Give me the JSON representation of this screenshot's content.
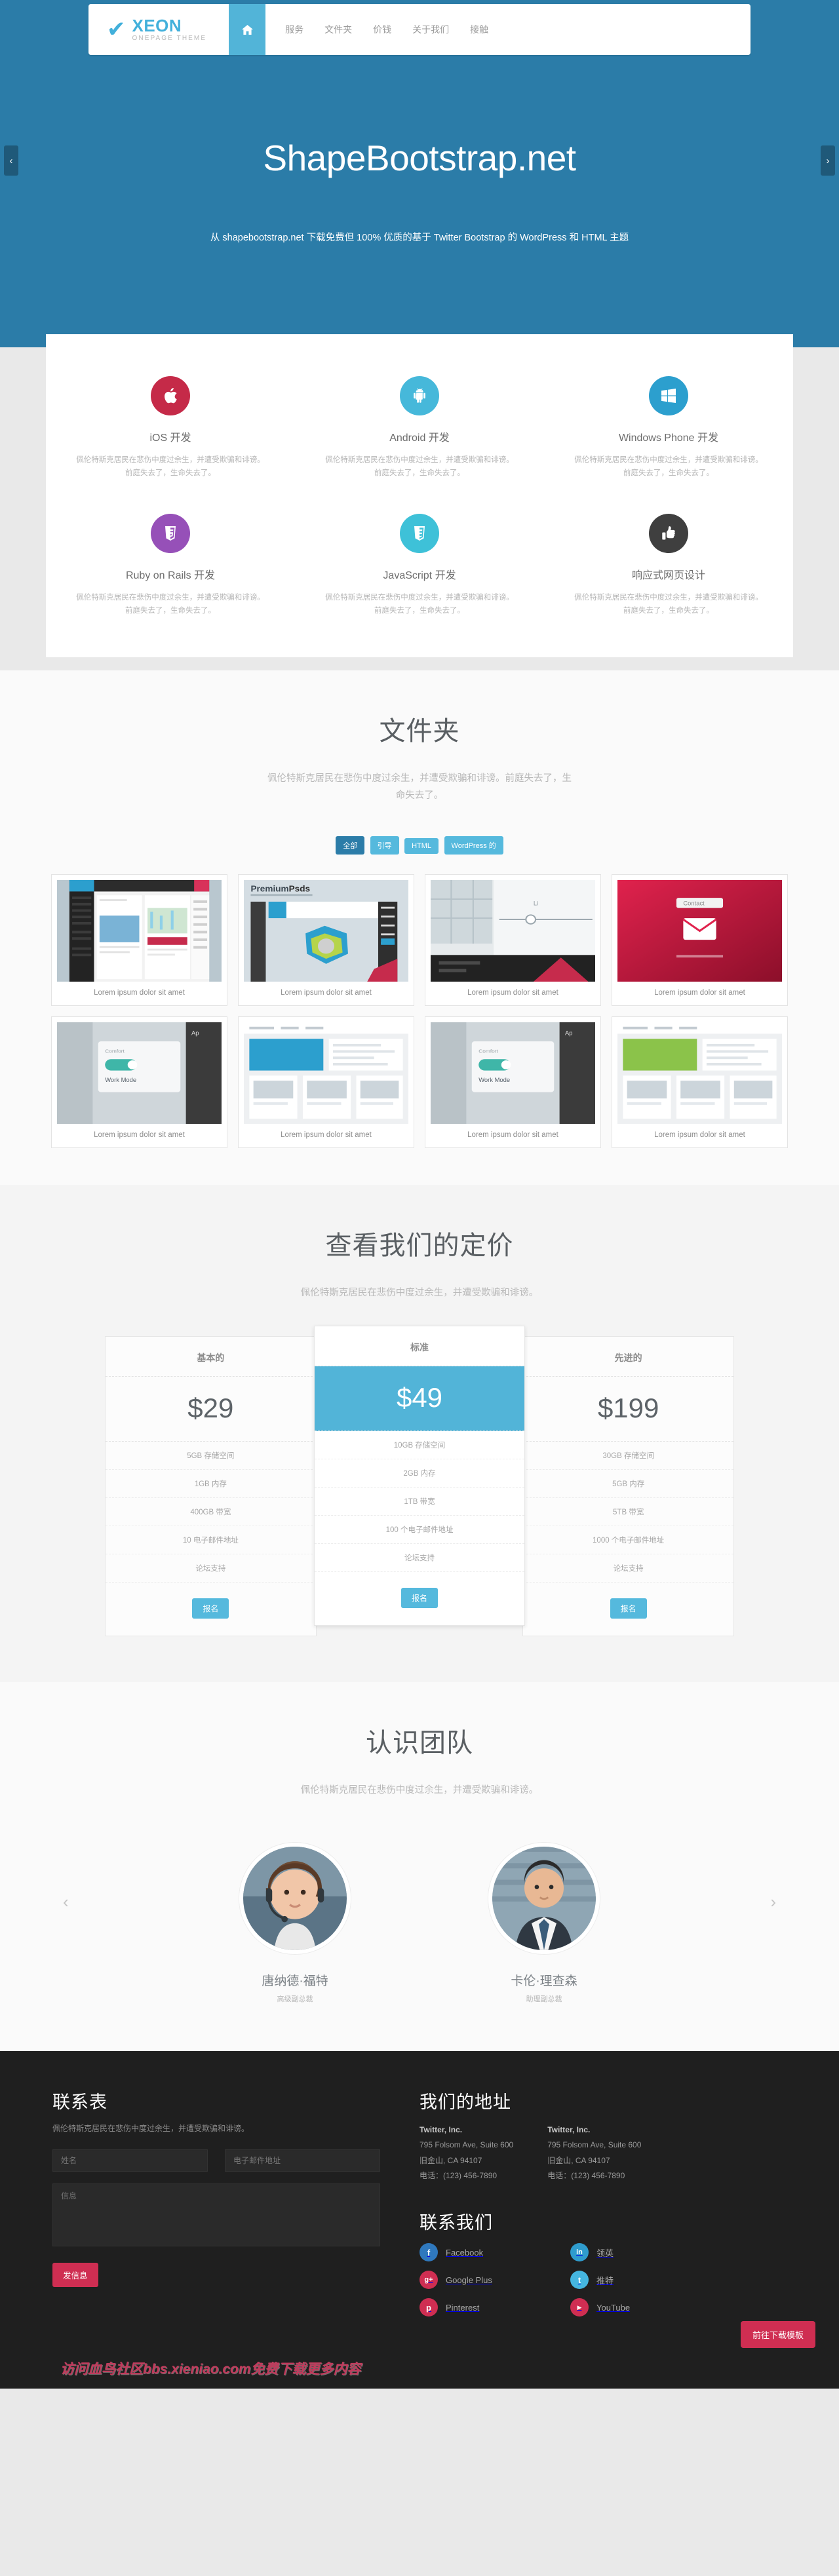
{
  "brand": {
    "name": "XEON",
    "tagline": "ONEPAGE THEME"
  },
  "nav": {
    "home_icon": "home-icon",
    "items": [
      {
        "label": "服务"
      },
      {
        "label": "文件夹"
      },
      {
        "label": "价钱"
      },
      {
        "label": "关于我们"
      },
      {
        "label": "接触"
      }
    ]
  },
  "hero": {
    "title": "ShapeBootstrap.net",
    "subtitle": "从 shapebootstrap.net 下载免费但 100% 优质的基于 Twitter Bootstrap 的 WordPress 和 HTML 主题",
    "prev": "‹",
    "next": "›"
  },
  "services": {
    "items": [
      {
        "title": "iOS 开发",
        "icon": "apple-icon",
        "color": "#c52a48",
        "desc": "佩伦特斯克居民在悲伤中度过余生，并遭受欺骗和诽谤。前庭失去了，生命失去了。"
      },
      {
        "title": "Android 开发",
        "icon": "android-icon",
        "color": "#46b8da",
        "desc": "佩伦特斯克居民在悲伤中度过余生，并遭受欺骗和诽谤。前庭失去了，生命失去了。"
      },
      {
        "title": "Windows Phone 开发",
        "icon": "windows-icon",
        "color": "#2c9fce",
        "desc": "佩伦特斯克居民在悲伤中度过余生，并遭受欺骗和诽谤。前庭失去了，生命失去了。"
      },
      {
        "title": "Ruby on Rails 开发",
        "icon": "html5-icon",
        "color": "#9650b8",
        "desc": "佩伦特斯克居民在悲伤中度过余生，并遭受欺骗和诽谤。前庭失去了，生命失去了。"
      },
      {
        "title": "JavaScript 开发",
        "icon": "css3-icon",
        "color": "#3ec1d8",
        "desc": "佩伦特斯克居民在悲伤中度过余生，并遭受欺骗和诽谤。前庭失去了，生命失去了。"
      },
      {
        "title": "响应式网页设计",
        "icon": "thumbs-up-icon",
        "color": "#3f3f3f",
        "desc": "佩伦特斯克居民在悲伤中度过余生，并遭受欺骗和诽谤。前庭失去了，生命失去了。"
      }
    ]
  },
  "portfolio": {
    "title": "文件夹",
    "subtitle": "佩伦特斯克居民在悲伤中度过余生，并遭受欺骗和诽谤。前庭失去了，生命失去了。",
    "filters": [
      {
        "label": "全部",
        "active": true
      },
      {
        "label": "引导",
        "active": false
      },
      {
        "label": "HTML",
        "active": false
      },
      {
        "label": "WordPress 的",
        "active": false
      }
    ],
    "items": [
      {
        "caption": "Lorem ipsum dolor sit amet",
        "thumb": "dashboard-dark-blue"
      },
      {
        "caption": "Lorem ipsum dolor sit amet",
        "thumb": "premiumpsds-chart"
      },
      {
        "caption": "Lorem ipsum dolor sit amet",
        "thumb": "map-card-light"
      },
      {
        "caption": "Lorem ipsum dolor sit amet",
        "thumb": "red-mail-app"
      },
      {
        "caption": "Lorem ipsum dolor sit amet",
        "thumb": "work-mode-toggle"
      },
      {
        "caption": "Lorem ipsum dolor sit amet",
        "thumb": "blue-admin-panel"
      },
      {
        "caption": "Lorem ipsum dolor sit amet",
        "thumb": "work-mode-toggle-2"
      },
      {
        "caption": "Lorem ipsum dolor sit amet",
        "thumb": "green-admin-panel"
      }
    ]
  },
  "pricing": {
    "title": "查看我们的定价",
    "subtitle": "佩伦特斯克居民在悲伤中度过余生，并遭受欺骗和诽谤。",
    "plans": [
      {
        "name": "基本的",
        "price": "$29",
        "featured": false,
        "cta": "报名",
        "features": [
          "5GB 存储空间",
          "1GB 内存",
          "400GB 带宽",
          "10 电子邮件地址",
          "论坛支持"
        ]
      },
      {
        "name": "标准",
        "price": "$49",
        "featured": true,
        "cta": "报名",
        "features": [
          "10GB 存储空间",
          "2GB 内存",
          "1TB 带宽",
          "100 个电子邮件地址",
          "论坛支持"
        ]
      },
      {
        "name": "先进的",
        "price": "$199",
        "featured": false,
        "cta": "报名",
        "features": [
          "30GB 存储空间",
          "5GB 内存",
          "5TB 带宽",
          "1000 个电子邮件地址",
          "论坛支持"
        ]
      }
    ]
  },
  "team": {
    "title": "认识团队",
    "subtitle": "佩伦特斯克居民在悲伤中度过余生，并遭受欺骗和诽谤。",
    "prev": "‹",
    "next": "›",
    "members": [
      {
        "name": "唐纳德·福特",
        "role": "高级副总裁",
        "photo": "woman-headset-photo"
      },
      {
        "name": "卡伦·理查森",
        "role": "助理副总裁",
        "photo": "man-suit-photo"
      }
    ]
  },
  "footer": {
    "contact_form": {
      "title": "联系表",
      "subtitle": "佩伦特斯克居民在悲伤中度过余生，并遭受欺骗和诽谤。",
      "name_placeholder": "姓名",
      "email_placeholder": "电子邮件地址",
      "message_placeholder": "信息",
      "send_label": "发信息"
    },
    "address": {
      "title": "我们的地址",
      "blocks": [
        {
          "company": "Twitter, Inc.",
          "street": "795 Folsom Ave, Suite 600",
          "city": "旧金山, CA 94107",
          "phone": "电话：(123) 456-7890"
        },
        {
          "company": "Twitter, Inc.",
          "street": "795 Folsom Ave, Suite 600",
          "city": "旧金山, CA 94107",
          "phone": "电话：(123) 456-7890"
        }
      ]
    },
    "social": {
      "title": "联系我们",
      "items": [
        {
          "label": "Facebook",
          "icon": "facebook-icon",
          "glyph": "f",
          "color": "#2f78bd"
        },
        {
          "label": "领英",
          "icon": "linkedin-icon",
          "glyph": "in",
          "color": "#2f9ccd"
        },
        {
          "label": "Google Plus",
          "icon": "googleplus-icon",
          "glyph": "g+",
          "color": "#cf2e52"
        },
        {
          "label": "推特",
          "icon": "twitter-icon",
          "glyph": "t",
          "color": "#45b6e0"
        },
        {
          "label": "Pinterest",
          "icon": "pinterest-icon",
          "glyph": "p",
          "color": "#cf2e52"
        },
        {
          "label": "YouTube",
          "icon": "youtube-icon",
          "glyph": "▶",
          "color": "#cf2e52"
        }
      ]
    },
    "download_label": "前往下载模板",
    "watermark": "访问血鸟社区bbs.xieniao.com免费下载更多内容"
  }
}
